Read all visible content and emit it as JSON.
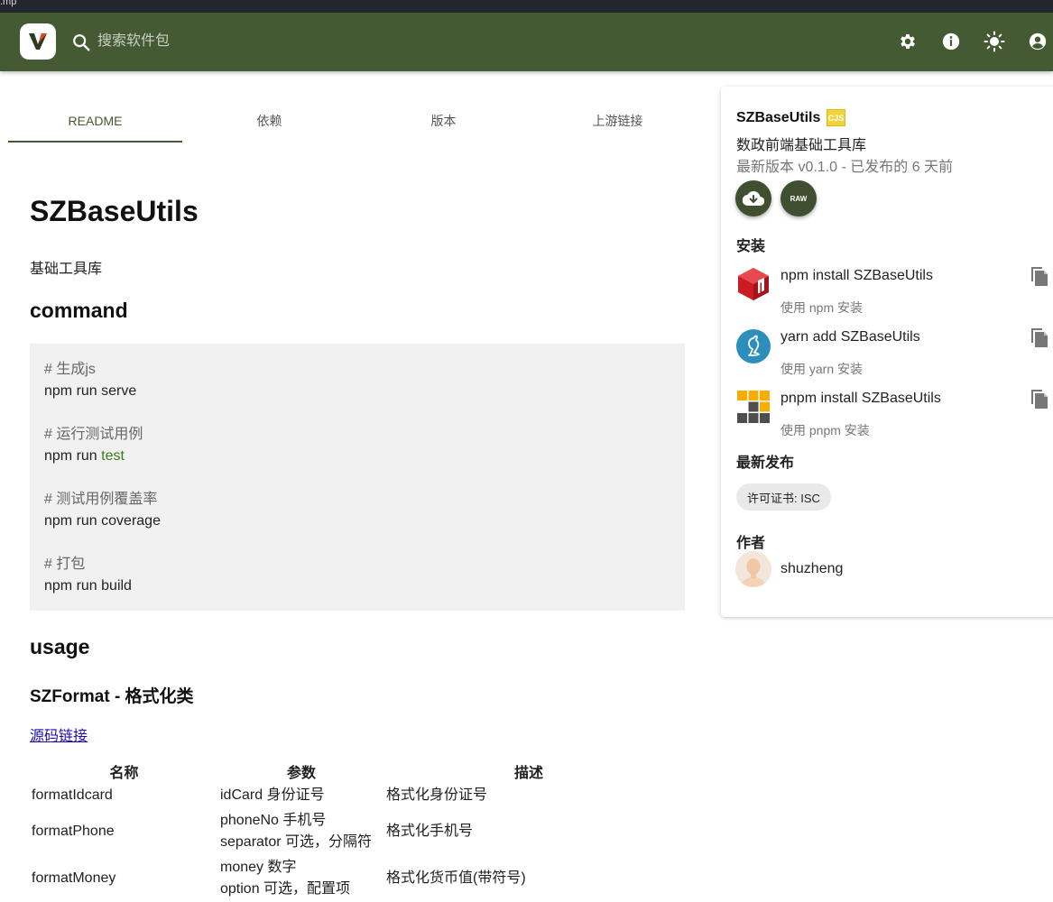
{
  "window": {
    "title_fragment": ".mp"
  },
  "appbar": {
    "search_placeholder": "搜索软件包"
  },
  "tabs": [
    {
      "label": "README",
      "active": true
    },
    {
      "label": "依赖",
      "active": false
    },
    {
      "label": "版本",
      "active": false
    },
    {
      "label": "上游链接",
      "active": false
    }
  ],
  "readme": {
    "title": "SZBaseUtils",
    "description": "基础工具库",
    "command_heading": "command",
    "code_lines": {
      "c1": "# 生成js",
      "l1": "npm run serve",
      "c2": "# 运行测试用例",
      "l2_prefix": "npm run ",
      "l2_keyword": "test",
      "c3": "# 测试用例覆盖率",
      "l3": "npm run coverage",
      "c4": "# 打包",
      "l4": "npm run build"
    },
    "usage_heading": "usage",
    "subheading": "SZFormat - 格式化类",
    "source_link": "源码链接",
    "table": {
      "headers": [
        "名称",
        "参数",
        "描述"
      ],
      "rows": [
        {
          "name": "formatIdcard",
          "params": [
            "idCard 身份证号"
          ],
          "desc": "格式化身份证号"
        },
        {
          "name": "formatPhone",
          "params": [
            "phoneNo 手机号",
            "separator 可选，分隔符"
          ],
          "desc": "格式化手机号"
        },
        {
          "name": "formatMoney",
          "params": [
            "money 数字",
            "option 可选，配置项"
          ],
          "desc": "格式化货币值(带符号)"
        }
      ]
    }
  },
  "sidebar": {
    "package_name": "SZBaseUtils",
    "module_badge": "CJS",
    "package_description": "数政前端基础工具库",
    "version_info": "最新版本 v0.1.0 - 已发布的 6 天前",
    "raw_label": "RAW",
    "install_heading": "安装",
    "install": [
      {
        "command": "npm install SZBaseUtils",
        "sub": "使用 npm 安装"
      },
      {
        "command": "yarn add SZBaseUtils",
        "sub": "使用 yarn 安装"
      },
      {
        "command": "pnpm install SZBaseUtils",
        "sub": "使用 pnpm 安装"
      }
    ],
    "latest_heading": "最新发布",
    "license_chip": "许可证书: ISC",
    "author_heading": "作者",
    "author_name": "shuzheng"
  },
  "colors": {
    "appbar": "#445a33",
    "accent": "#445a33",
    "button": "#3f4f30"
  }
}
